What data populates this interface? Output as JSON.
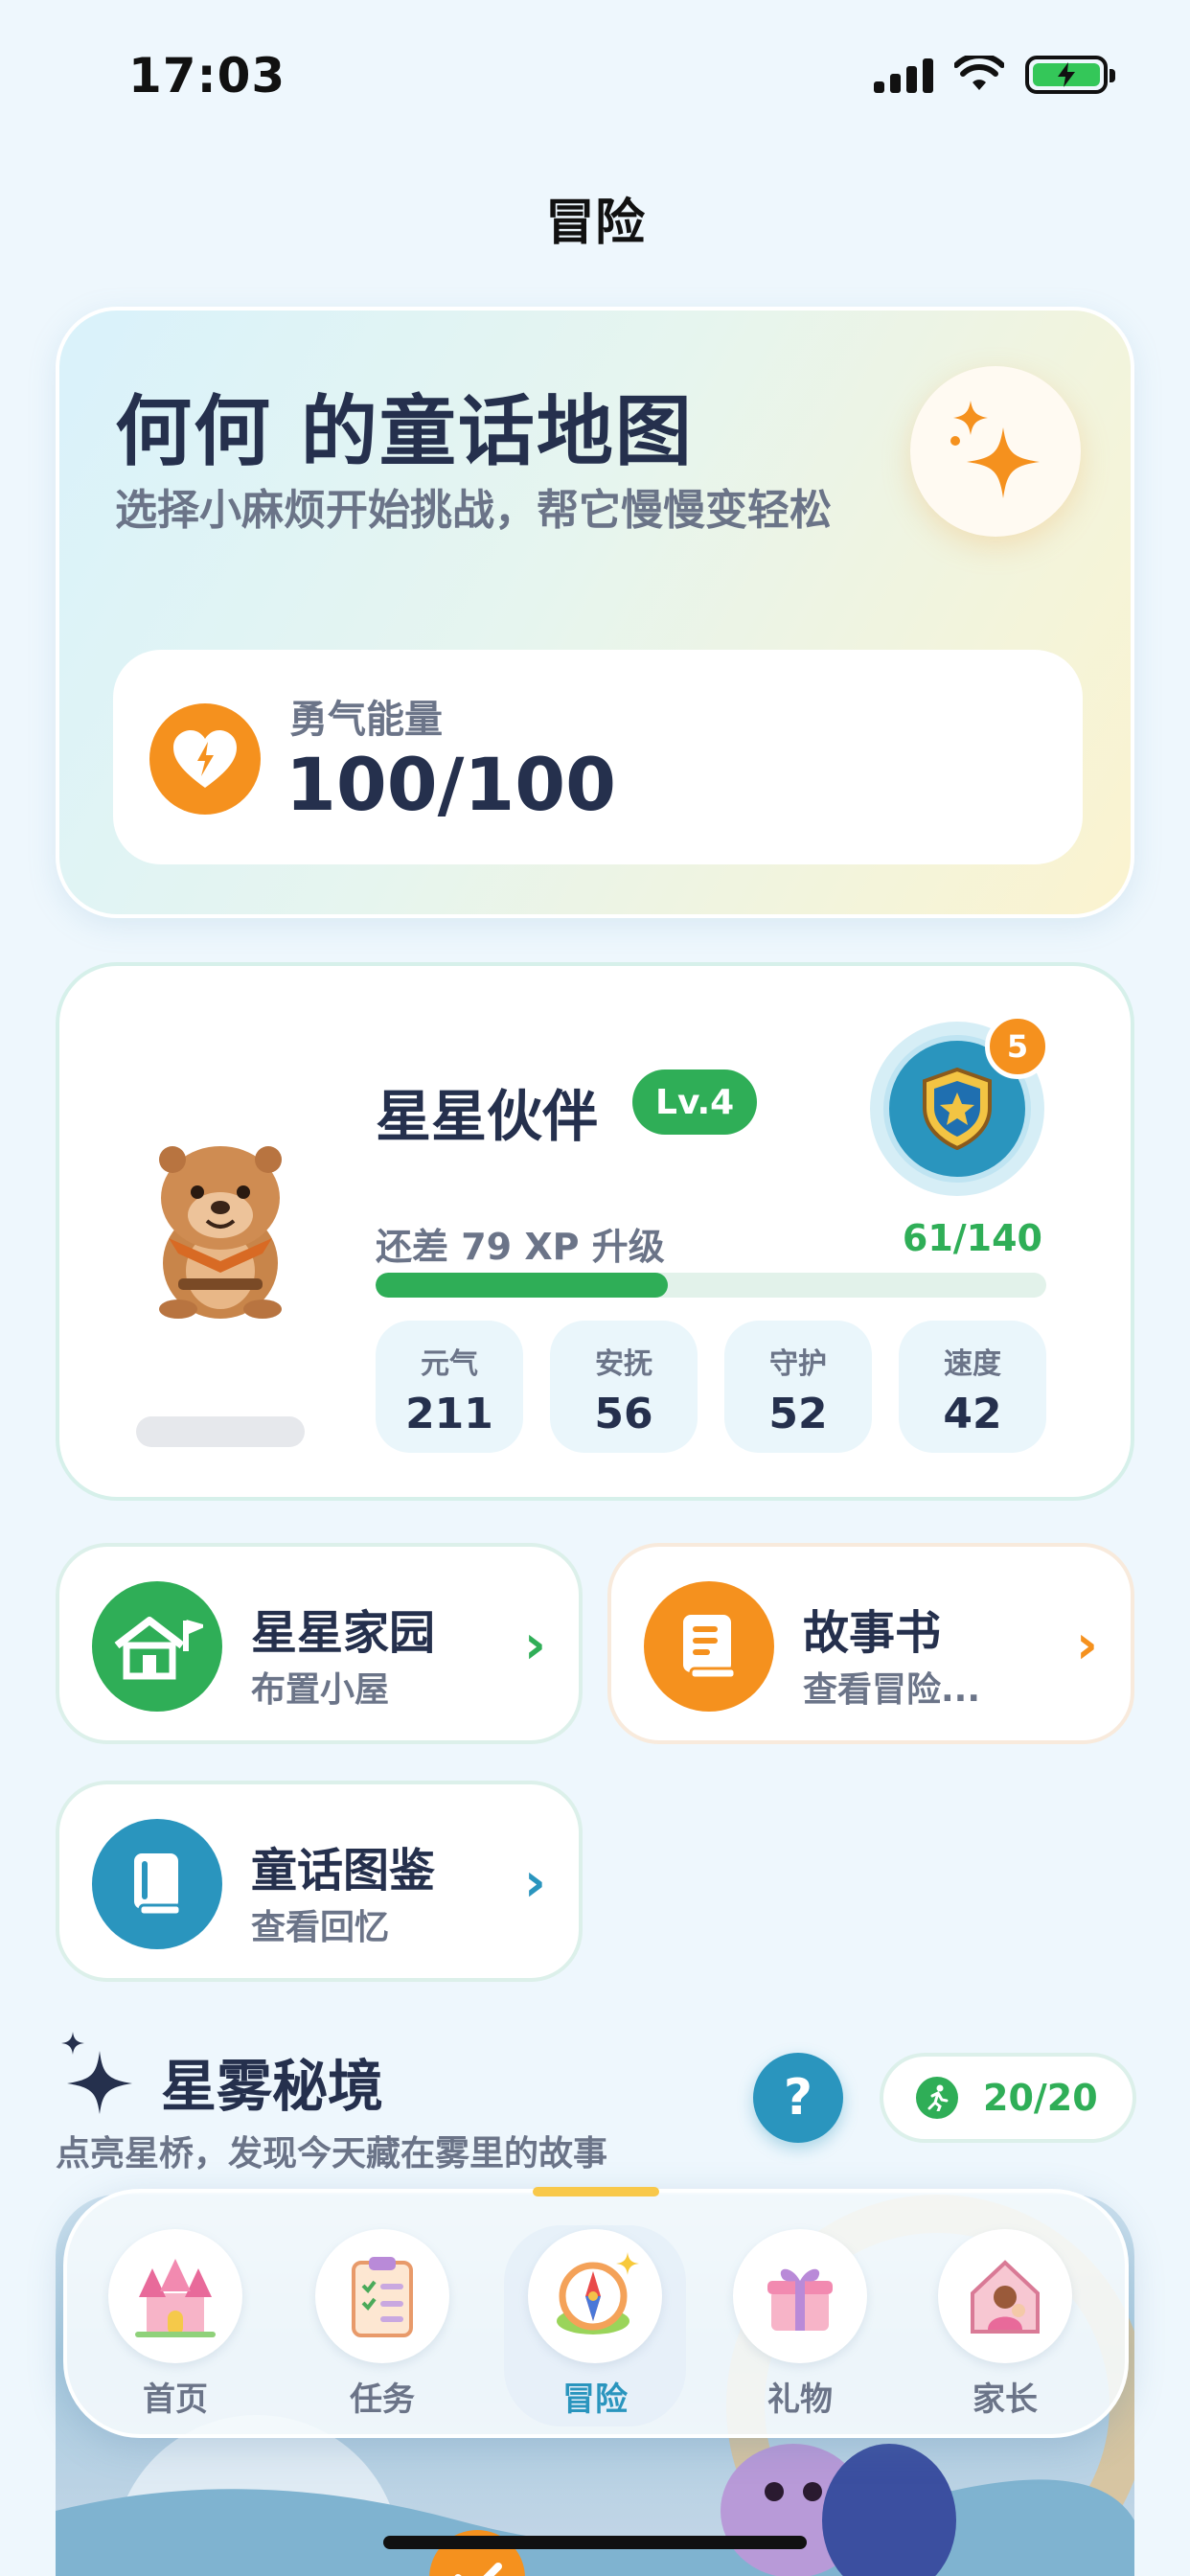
{
  "status_bar": {
    "time": "17:03"
  },
  "header": {
    "title": "冒险"
  },
  "hero": {
    "title": "何何 的童话地图",
    "subtitle": "选择小麻烦开始挑战，帮它慢慢变轻松",
    "energy": {
      "label": "勇气能量",
      "value": "100/100"
    }
  },
  "partner": {
    "name": "星星伙伴",
    "level": "Lv.4",
    "medal_count": "5",
    "xp_text": "还差 79 XP 升级",
    "xp_progress": "61/140",
    "xp_fraction": 0.436,
    "stats": [
      {
        "label": "元气",
        "value": "211"
      },
      {
        "label": "安抚",
        "value": "56"
      },
      {
        "label": "守护",
        "value": "52"
      },
      {
        "label": "速度",
        "value": "42"
      }
    ]
  },
  "shortcuts": [
    {
      "title": "星星家园",
      "subtitle": "布置小屋",
      "color": "#2fae57",
      "icon": "house-icon"
    },
    {
      "title": "故事书",
      "subtitle": "查看冒险...",
      "color": "#f5911e",
      "icon": "book-icon"
    },
    {
      "title": "童话图鉴",
      "subtitle": "查看回忆",
      "color": "#2a95be",
      "icon": "album-icon"
    }
  ],
  "mist": {
    "title": "星雾秘境",
    "subtitle": "点亮星桥，发现今天藏在雾里的故事",
    "help": "?",
    "stamina": "20/20"
  },
  "tabs": [
    {
      "label": "首页",
      "icon": "castle-icon"
    },
    {
      "label": "任务",
      "icon": "clipboard-icon"
    },
    {
      "label": "冒险",
      "icon": "compass-icon"
    },
    {
      "label": "礼物",
      "icon": "gift-icon"
    },
    {
      "label": "家长",
      "icon": "parent-icon"
    }
  ],
  "colors": {
    "green": "#2fae57",
    "orange": "#f5911e",
    "blue": "#2a95be",
    "text": "#25304d",
    "muted": "#6b7488"
  }
}
